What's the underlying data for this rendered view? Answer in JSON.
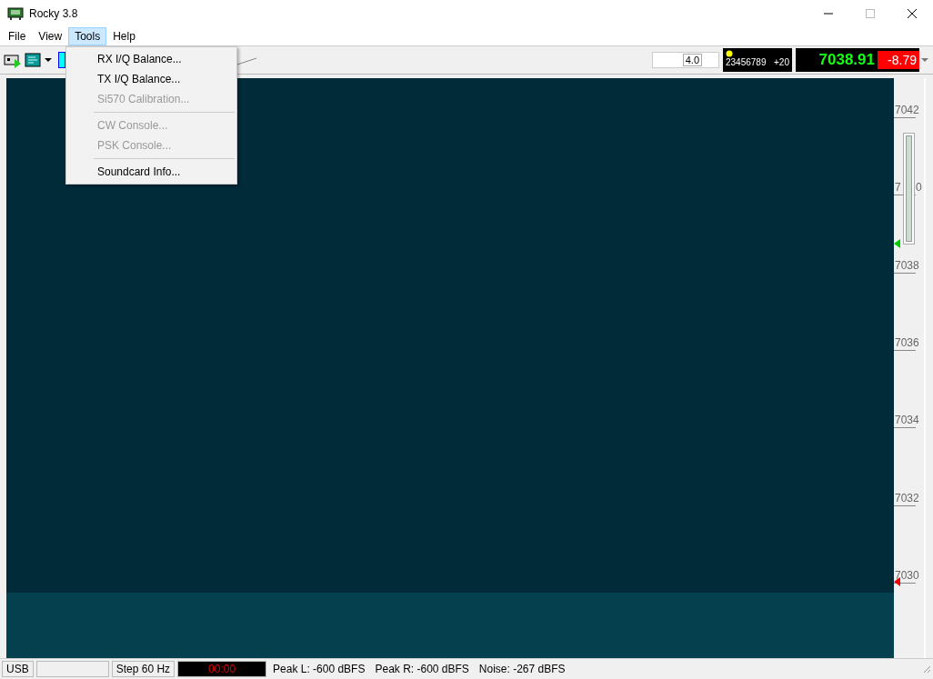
{
  "window": {
    "title": "Rocky 3.8"
  },
  "menu_bar": [
    {
      "label": "File",
      "selected": false
    },
    {
      "label": "View",
      "selected": false
    },
    {
      "label": "Tools",
      "selected": true
    },
    {
      "label": "Help",
      "selected": false
    }
  ],
  "tools_menu": [
    {
      "kind": "item",
      "label": "RX I/Q Balance...",
      "disabled": false
    },
    {
      "kind": "item",
      "label": "TX I/Q Balance...",
      "disabled": false
    },
    {
      "kind": "item",
      "label": "Si570 Calibration...",
      "disabled": true
    },
    {
      "kind": "separator"
    },
    {
      "kind": "item",
      "label": "CW Console...",
      "disabled": true
    },
    {
      "kind": "item",
      "label": "PSK Console...",
      "disabled": true
    },
    {
      "kind": "separator"
    },
    {
      "kind": "item",
      "label": "Soundcard Info...",
      "disabled": false
    }
  ],
  "toolbar": {
    "value_field": "4.0",
    "band_display": {
      "digits": "23456789",
      "offset": "+20"
    },
    "frequency": "7038.91",
    "level_reading": "-8.79"
  },
  "scale": [
    {
      "text": "7042"
    },
    {
      "text": "7",
      "tail": "0"
    },
    {
      "text": "7038"
    },
    {
      "text": "7036"
    },
    {
      "text": "7034"
    },
    {
      "text": "7032"
    },
    {
      "text": "7030"
    }
  ],
  "gain_slider": {
    "level": 1
  },
  "status_bar": [
    "USB",
    "Step 60 Hz",
    "00:00",
    "Peak L: -600 dBFS",
    "Peak R: -600 dBFS",
    "Noise: -267 dBFS"
  ]
}
